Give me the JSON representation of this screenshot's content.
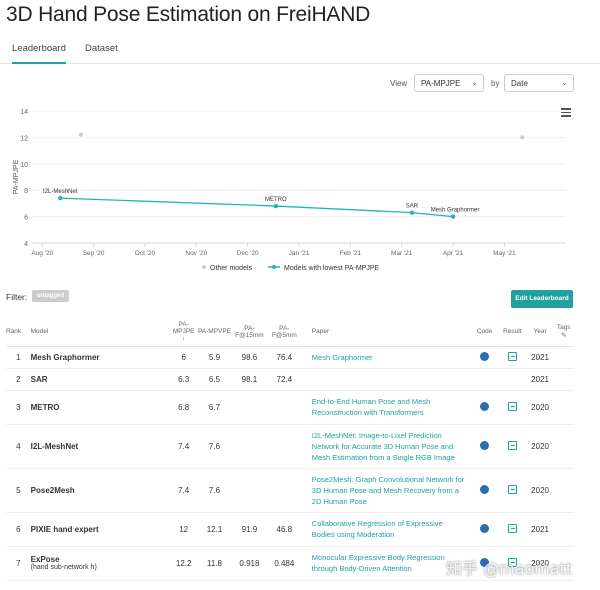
{
  "page": {
    "title": "3D Hand Pose Estimation on FreiHAND",
    "tabs": [
      "Leaderboard",
      "Dataset"
    ],
    "view_label": "View",
    "view_value": "PA-MPJPE",
    "by_label": "by",
    "by_value": "Date",
    "filter_label": "Filter:",
    "filter_tag": "untagged",
    "edit_button": "Edit Leaderboard",
    "watermark": "知乎 @maomatt"
  },
  "table": {
    "headers": {
      "rank": "Rank",
      "model": "Model",
      "c1": "PA-MPJPE",
      "c2": "PA-MPVPE",
      "c3": "PA-F@15mm",
      "c4": "PA-F@5mm",
      "paper": "Paper",
      "code": "Code",
      "result": "Result",
      "year": "Year",
      "tags": "Tags"
    },
    "rows": [
      {
        "rank": "1",
        "model": "Mesh Graphormer",
        "sub": "",
        "c1": "6",
        "c2": "5.9",
        "c3": "98.6",
        "c4": "76.4",
        "paper": "Mesh Graphormer",
        "code": true,
        "result": true,
        "year": "2021"
      },
      {
        "rank": "2",
        "model": "SAR",
        "sub": "",
        "c1": "6.3",
        "c2": "6.5",
        "c3": "98.1",
        "c4": "72.4",
        "paper": "",
        "code": false,
        "result": false,
        "year": "2021"
      },
      {
        "rank": "3",
        "model": "METRO",
        "sub": "",
        "c1": "6.8",
        "c2": "6.7",
        "c3": "",
        "c4": "",
        "paper": "End-to-End Human Pose and Mesh Reconstruction with Transformers",
        "code": true,
        "result": true,
        "year": "2020"
      },
      {
        "rank": "4",
        "model": "I2L-MeshNet",
        "sub": "",
        "c1": "7.4",
        "c2": "7.6",
        "c3": "",
        "c4": "",
        "paper": "I2L-MeshNet: Image-to-Lixel Prediction Network for Accurate 3D Human Pose and Mesh Estimation from a Single RGB Image",
        "code": true,
        "result": true,
        "year": "2020"
      },
      {
        "rank": "5",
        "model": "Pose2Mesh",
        "sub": "",
        "c1": "7.4",
        "c2": "7.6",
        "c3": "",
        "c4": "",
        "paper": "Pose2Mesh: Graph Convolutional Network for 3D Human Pose and Mesh Recovery from a 2D Human Pose",
        "code": true,
        "result": true,
        "year": "2020"
      },
      {
        "rank": "6",
        "model": "PIXIE hand expert",
        "sub": "",
        "c1": "12",
        "c2": "12.1",
        "c3": "91.9",
        "c4": "46.8",
        "paper": "Collaborative Regression of Expressive Bodies using Moderation",
        "code": true,
        "result": true,
        "year": "2021"
      },
      {
        "rank": "7",
        "model": "ExPose",
        "sub": "(hand sub-network h)",
        "c1": "12.2",
        "c2": "11.8",
        "c3": "0.918",
        "c4": "0.484",
        "paper": "Monocular Expressive Body Regression through Body-Driven Attention",
        "code": true,
        "result": true,
        "year": "2020"
      }
    ]
  },
  "chart_data": {
    "type": "line",
    "ylabel": "PA-MPJPE",
    "ylim": [
      4,
      14
    ],
    "yticks": [
      4,
      6,
      8,
      10,
      12,
      14
    ],
    "xticks": [
      "Aug '20",
      "Sep '20",
      "Oct '20",
      "Nov '20",
      "Dec '20",
      "Jan '21",
      "Feb '21",
      "Mar '21",
      "Apr '21",
      "May '21"
    ],
    "series": [
      {
        "name": "Models with lowest PA-MPJPE",
        "color": "#21b5b5",
        "points": [
          {
            "month": 0.35,
            "value": 7.4,
            "label": "I2L-MeshNet"
          },
          {
            "month": 4.55,
            "value": 6.8,
            "label": "METRO"
          },
          {
            "month": 7.2,
            "value": 6.3,
            "label": "SAR"
          },
          {
            "month": 8.0,
            "value": 6.0,
            "label": "Mesh Graphormer"
          }
        ]
      },
      {
        "name": "Other models",
        "color": "#cccccc",
        "points": [
          {
            "month": 0.75,
            "value": 12.2
          },
          {
            "month": 9.35,
            "value": 12.0
          }
        ]
      }
    ]
  }
}
